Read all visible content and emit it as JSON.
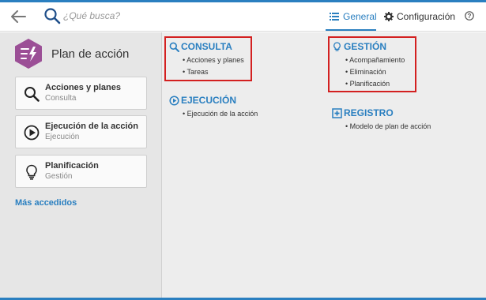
{
  "header": {
    "search_placeholder": "¿Qué busca?",
    "tabs": [
      {
        "label": "General",
        "active": true
      },
      {
        "label": "Configuración",
        "active": false
      }
    ]
  },
  "colors": {
    "accent": "#2a7fc0",
    "app_icon": "#9b4f96",
    "highlight": "#d32020"
  },
  "sidebar": {
    "app_title": "Plan de acción",
    "cards": [
      {
        "title": "Acciones y planes",
        "subtitle": "Consulta",
        "icon": "search-icon"
      },
      {
        "title": "Ejecución de la acción",
        "subtitle": "Ejecución",
        "icon": "play-circle-icon"
      },
      {
        "title": "Planificación",
        "subtitle": "Gestión",
        "icon": "lightbulb-icon"
      }
    ],
    "most_accessed": "Más accedidos"
  },
  "main": {
    "consulta": {
      "title": "CONSULTA",
      "icon": "search-icon",
      "items": [
        "Acciones y planes",
        "Tareas"
      ]
    },
    "ejecucion": {
      "title": "EJECUCIÓN",
      "icon": "play-circle-icon",
      "items": [
        "Ejecución de la acción"
      ]
    },
    "gestion": {
      "title": "GESTIÓN",
      "icon": "lightbulb-icon",
      "items": [
        "Acompañamiento",
        "Eliminación",
        "Planificación"
      ]
    },
    "registro": {
      "title": "REGISTRO",
      "icon": "plus-square-icon",
      "items": [
        "Modelo de plan de acción"
      ]
    }
  }
}
